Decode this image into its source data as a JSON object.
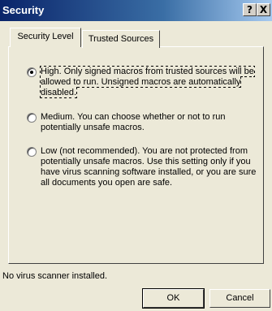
{
  "window": {
    "title": "Security",
    "help_label": "?",
    "close_label": "X"
  },
  "tabs": [
    {
      "label": "Security Level",
      "active": true
    },
    {
      "label": "Trusted Sources",
      "active": false
    }
  ],
  "options": [
    {
      "text": "High. Only signed macros from trusted sources will be allowed to run. Unsigned macros are automatically disabled.",
      "selected": true
    },
    {
      "text": "Medium. You can choose whether or not to run potentially unsafe macros.",
      "selected": false
    },
    {
      "text": "Low (not recommended). You are not protected from potentially unsafe macros. Use this setting only if you have virus scanning software installed, or you are sure all documents you open are safe.",
      "selected": false
    }
  ],
  "status": "No virus scanner installed.",
  "buttons": {
    "ok": "OK",
    "cancel": "Cancel"
  }
}
